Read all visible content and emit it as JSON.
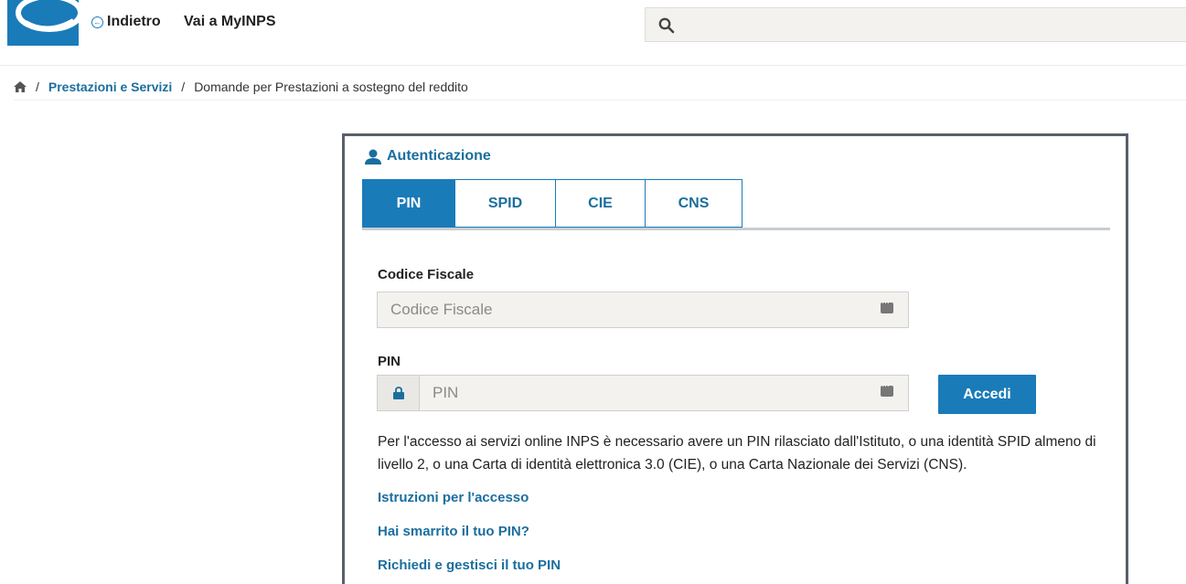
{
  "header": {
    "back_label": "Indietro",
    "mypage_label": "Vai a MyINPS",
    "search_placeholder": "",
    "brand_color": "#1a7bb9"
  },
  "breadcrumb": {
    "items": [
      "Prestazioni e Servizi",
      "Domande per Prestazioni a sostegno del reddito"
    ],
    "separator": "/"
  },
  "auth": {
    "title": "Autenticazione",
    "tabs": [
      {
        "label": "PIN",
        "active": true
      },
      {
        "label": "SPID",
        "active": false
      },
      {
        "label": "CIE",
        "active": false
      },
      {
        "label": "CNS",
        "active": false
      }
    ],
    "codice_fiscale_label": "Codice Fiscale",
    "codice_fiscale_placeholder": "Codice Fiscale",
    "pin_label": "PIN",
    "pin_placeholder": "PIN",
    "submit_label": "Accedi",
    "info_text": "Per l'accesso ai servizi online INPS è necessario avere un PIN rilasciato dall'Istituto, o una identità SPID almeno di livello 2, o una Carta di identità elettronica 3.0 (CIE), o una Carta Nazionale dei Servizi (CNS).",
    "links": [
      "Istruzioni per l'accesso",
      "Hai smarrito il tuo PIN?",
      "Richiedi e gestisci il tuo PIN"
    ]
  }
}
